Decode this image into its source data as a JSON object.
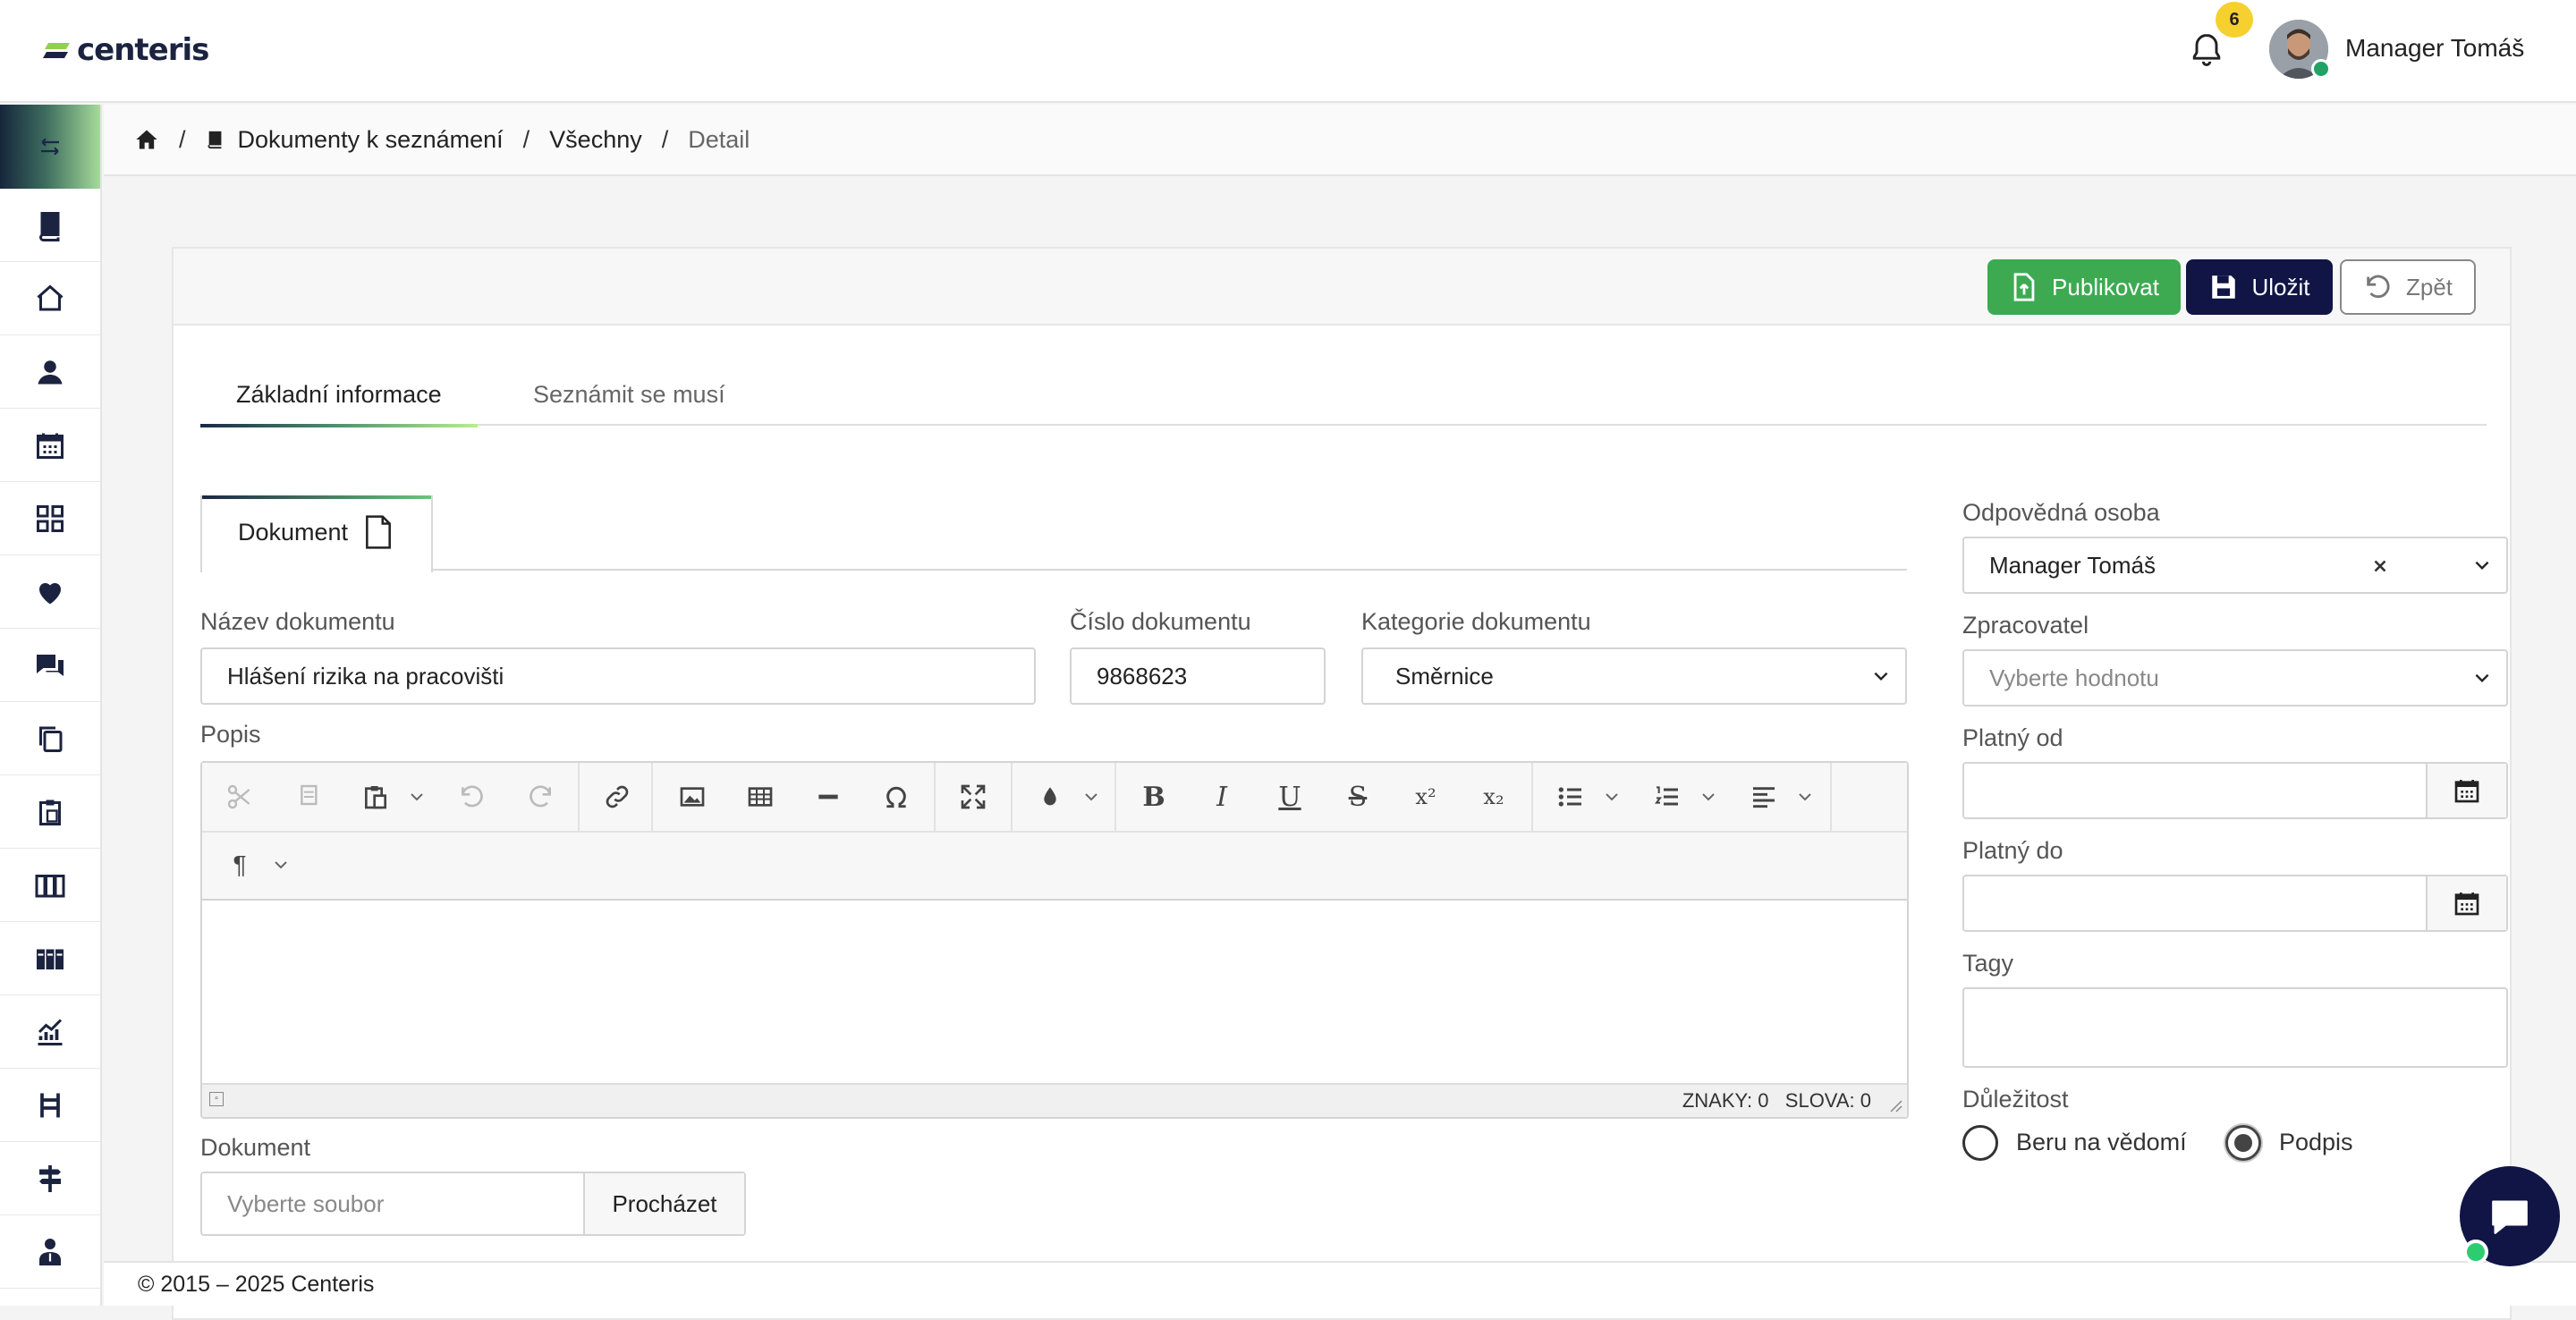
{
  "header": {
    "logo": "centeris",
    "notifications_count": "6",
    "user_name": "Manager Tomáš"
  },
  "breadcrumb": {
    "items": [
      "Dokumenty k seznámení",
      "Všechny",
      "Detail"
    ],
    "separator": "/"
  },
  "actions": {
    "publish": "Publikovat",
    "save": "Uložit",
    "back": "Zpět"
  },
  "tabs": [
    "Základní informace",
    "Seznámit se musí"
  ],
  "subtab": "Dokument",
  "form": {
    "name_label": "Název dokumentu",
    "name_value": "Hlášení rizika na pracovišti",
    "number_label": "Číslo dokumentu",
    "number_value": "9868623",
    "category_label": "Kategorie dokumentu",
    "category_value": "Směrnice",
    "description_label": "Popis",
    "editor_counts": "ZNAKY: 0   SLOVA: 0",
    "file_label": "Dokument",
    "file_placeholder": "Vyberte soubor",
    "file_button": "Procházet",
    "responsible_label": "Odpovědná osoba",
    "responsible_value": "Manager Tomáš",
    "processor_label": "Zpracovatel",
    "processor_placeholder": "Vyberte hodnotu",
    "valid_from_label": "Platný od",
    "valid_to_label": "Platný do",
    "tags_label": "Tagy",
    "importance_label": "Důležitost",
    "importance_options": [
      "Beru na vědomí",
      "Podpis"
    ],
    "importance_selected": "Podpis"
  },
  "footer": "© 2015 – 2025 Centeris",
  "colors": {
    "publish": "#3daa52",
    "save": "#101545",
    "badge": "#f5d02e",
    "online": "#21a366"
  }
}
